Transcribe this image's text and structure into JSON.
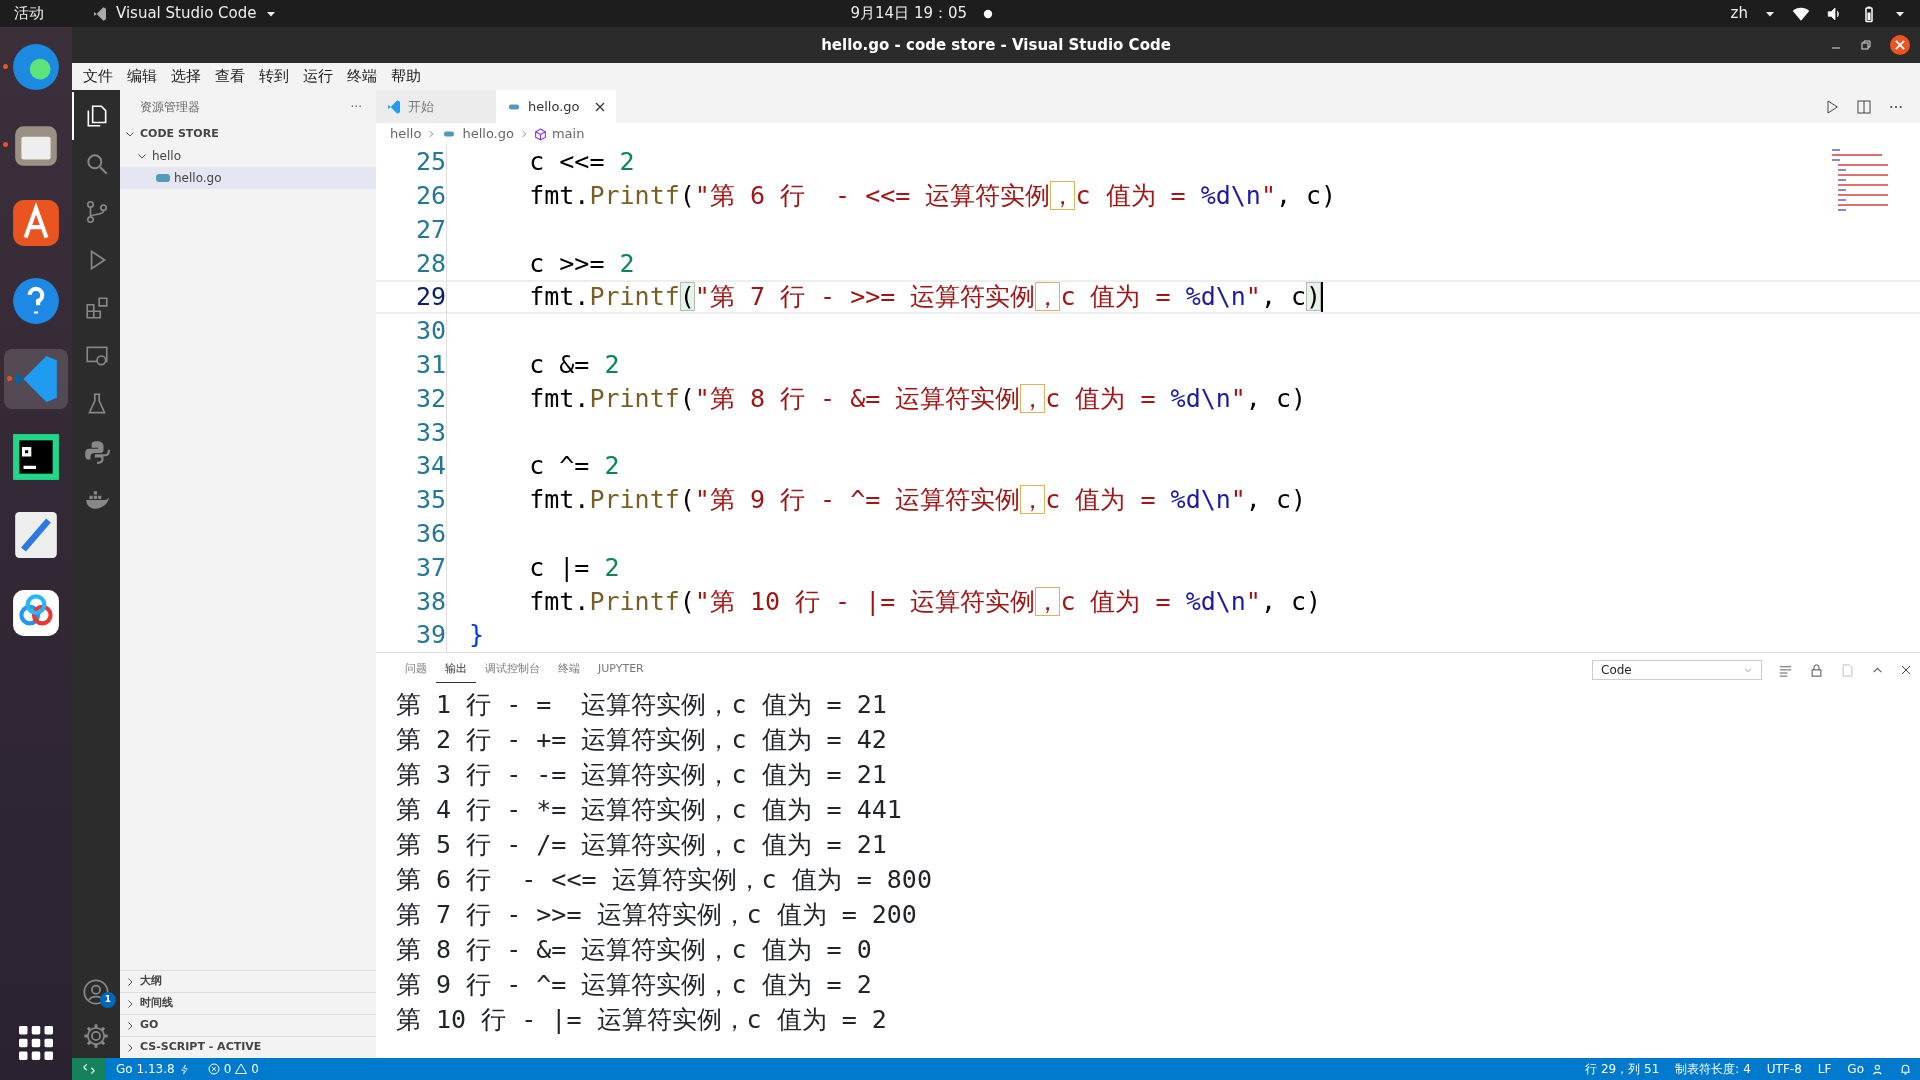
{
  "top_bar": {
    "activities": "活动",
    "app_menu": "Visual Studio Code",
    "clock": "9月14日 19：05",
    "input_method": "zh"
  },
  "dock": {
    "apps": [
      {
        "kind": "browser",
        "active": false
      },
      {
        "kind": "files",
        "active": false
      },
      {
        "kind": "store",
        "active": false
      },
      {
        "kind": "help",
        "active": false
      },
      {
        "kind": "vscode",
        "active": true
      },
      {
        "kind": "pycharm",
        "active": false
      },
      {
        "kind": "editor",
        "active": false
      },
      {
        "kind": "cloud",
        "active": false
      }
    ]
  },
  "window": {
    "title": "hello.go - code store - Visual Studio Code"
  },
  "menu": [
    "文件",
    "编辑",
    "选择",
    "查看",
    "转到",
    "运行",
    "终端",
    "帮助"
  ],
  "activity_bar": {
    "items": [
      {
        "kind": "explorer",
        "selected": true
      },
      {
        "kind": "search",
        "selected": false
      },
      {
        "kind": "git",
        "selected": false
      },
      {
        "kind": "debug",
        "selected": false
      },
      {
        "kind": "extensions",
        "selected": false
      },
      {
        "kind": "remote",
        "selected": false
      },
      {
        "kind": "flask",
        "selected": false
      },
      {
        "kind": "python",
        "selected": false
      },
      {
        "kind": "docker",
        "selected": false
      }
    ],
    "account_badge": "1"
  },
  "sidebar": {
    "title": "资源管理器",
    "more": "···",
    "folder": {
      "label": "CODE STORE",
      "expanded": true,
      "children": [
        {
          "label": "hello",
          "expanded": true,
          "children": [
            {
              "label": "hello.go",
              "selected": true
            }
          ]
        }
      ]
    },
    "sections": [
      {
        "label": "大纲",
        "expanded": false
      },
      {
        "label": "时间线",
        "expanded": false
      },
      {
        "label": "GO",
        "expanded": false
      },
      {
        "label": "CS-SCRIPT - ACTIVE",
        "expanded": false
      }
    ]
  },
  "tabs": [
    {
      "label": "开始",
      "kind": "welcome",
      "selected": false
    },
    {
      "label": "hello.go",
      "kind": "go",
      "selected": true
    }
  ],
  "breadcrumb": [
    "hello",
    "hello.go",
    "main"
  ],
  "code_lines": [
    {
      "number": "25",
      "current": false,
      "tokens": [
        {
          "kind": "plain",
          "text": "    c <<= "
        },
        {
          "kind": "number",
          "text": "2"
        }
      ]
    },
    {
      "number": "26",
      "current": false,
      "tokens": [
        {
          "kind": "plain",
          "text": "    fmt."
        },
        {
          "kind": "func",
          "text": "Printf"
        },
        {
          "kind": "plain",
          "text": "("
        },
        {
          "kind": "string",
          "text": "\"第 6 行  - <<= 运算符实例"
        },
        {
          "kind": "highlight",
          "text": "，"
        },
        {
          "kind": "string",
          "text": "c 值为 = "
        },
        {
          "kind": "escape",
          "text": "%d\\n"
        },
        {
          "kind": "string",
          "text": "\""
        },
        {
          "kind": "plain",
          "text": ", c)"
        }
      ]
    },
    {
      "number": "27",
      "current": false
    },
    {
      "number": "28",
      "current": false,
      "tokens": [
        {
          "kind": "plain",
          "text": "    c >>= "
        },
        {
          "kind": "number",
          "text": "2"
        }
      ]
    },
    {
      "number": "29",
      "current": true,
      "tokens": [
        {
          "kind": "plain",
          "text": "    fmt."
        },
        {
          "kind": "func",
          "text": "Printf"
        },
        {
          "kind": "match",
          "text": "("
        },
        {
          "kind": "string",
          "text": "\"第 7 行 - >>= 运算符实例"
        },
        {
          "kind": "highlight",
          "text": "，"
        },
        {
          "kind": "string",
          "text": "c 值为 = "
        },
        {
          "kind": "escape",
          "text": "%d\\n"
        },
        {
          "kind": "string",
          "text": "\""
        },
        {
          "kind": "plain",
          "text": ", c"
        },
        {
          "kind": "match",
          "text": ")"
        }
      ]
    },
    {
      "number": "30",
      "current": false
    },
    {
      "number": "31",
      "current": false,
      "tokens": [
        {
          "kind": "plain",
          "text": "    c &= "
        },
        {
          "kind": "number",
          "text": "2"
        }
      ]
    },
    {
      "number": "32",
      "current": false,
      "tokens": [
        {
          "kind": "plain",
          "text": "    fmt."
        },
        {
          "kind": "func",
          "text": "Printf"
        },
        {
          "kind": "plain",
          "text": "("
        },
        {
          "kind": "string",
          "text": "\"第 8 行 - &= 运算符实例"
        },
        {
          "kind": "highlight",
          "text": "，"
        },
        {
          "kind": "string",
          "text": "c 值为 = "
        },
        {
          "kind": "escape",
          "text": "%d\\n"
        },
        {
          "kind": "string",
          "text": "\""
        },
        {
          "kind": "plain",
          "text": ", c)"
        }
      ]
    },
    {
      "number": "33",
      "current": false
    },
    {
      "number": "34",
      "current": false,
      "tokens": [
        {
          "kind": "plain",
          "text": "    c ^= "
        },
        {
          "kind": "number",
          "text": "2"
        }
      ]
    },
    {
      "number": "35",
      "current": false,
      "tokens": [
        {
          "kind": "plain",
          "text": "    fmt."
        },
        {
          "kind": "func",
          "text": "Printf"
        },
        {
          "kind": "plain",
          "text": "("
        },
        {
          "kind": "string",
          "text": "\"第 9 行 - ^= 运算符实例"
        },
        {
          "kind": "highlight",
          "text": "，"
        },
        {
          "kind": "string",
          "text": "c 值为 = "
        },
        {
          "kind": "escape",
          "text": "%d\\n"
        },
        {
          "kind": "string",
          "text": "\""
        },
        {
          "kind": "plain",
          "text": ", c)"
        }
      ]
    },
    {
      "number": "36",
      "current": false
    },
    {
      "number": "37",
      "current": false,
      "tokens": [
        {
          "kind": "plain",
          "text": "    c |= "
        },
        {
          "kind": "number",
          "text": "2"
        }
      ]
    },
    {
      "number": "38",
      "current": false,
      "tokens": [
        {
          "kind": "plain",
          "text": "    fmt."
        },
        {
          "kind": "func",
          "text": "Printf"
        },
        {
          "kind": "plain",
          "text": "("
        },
        {
          "kind": "string",
          "text": "\"第 10 行 - |= 运算符实例"
        },
        {
          "kind": "highlight",
          "text": "，"
        },
        {
          "kind": "string",
          "text": "c 值为 = "
        },
        {
          "kind": "escape",
          "text": "%d\\n"
        },
        {
          "kind": "string",
          "text": "\""
        },
        {
          "kind": "plain",
          "text": ", c)"
        }
      ]
    },
    {
      "number": "39",
      "current": false,
      "tokens": [
        {
          "kind": "brace",
          "text": "}"
        }
      ]
    }
  ],
  "panel": {
    "tabs": [
      {
        "label": "问题",
        "selected": false
      },
      {
        "label": "输出",
        "selected": true
      },
      {
        "label": "调试控制台",
        "selected": false
      },
      {
        "label": "终端",
        "selected": false
      },
      {
        "label": "JUPYTER",
        "selected": false
      }
    ],
    "channel": "Code",
    "output": [
      "第 1 行 - =  运算符实例，c 值为 = 21",
      "第 2 行 - += 运算符实例，c 值为 = 42",
      "第 3 行 - -= 运算符实例，c 值为 = 21",
      "第 4 行 - *= 运算符实例，c 值为 = 441",
      "第 5 行 - /= 运算符实例，c 值为 = 21",
      "第 6 行  - <<= 运算符实例，c 值为 = 800",
      "第 7 行 - >>= 运算符实例，c 值为 = 200",
      "第 8 行 - &= 运算符实例，c 值为 = 0",
      "第 9 行 - ^= 运算符实例，c 值为 = 2",
      "第 10 行 - |= 运算符实例，c 值为 = 2"
    ]
  },
  "status_bar": {
    "go_version": "Go 1.13.8",
    "errors": "0",
    "warnings": "0",
    "position": "行 29，列 51",
    "tab_size": "制表符长度: 4",
    "encoding": "UTF-8",
    "eol": "LF",
    "language": "Go"
  }
}
